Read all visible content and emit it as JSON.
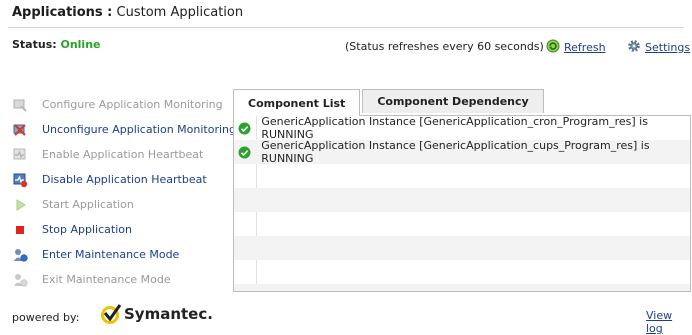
{
  "header": {
    "label": "Applications :",
    "app_name": "Custom Application"
  },
  "status": {
    "label": "Status:",
    "value": "Online",
    "value_color": "#2da12d"
  },
  "refresh": {
    "note": "(Status refreshes every 60 seconds)",
    "refresh_label": "Refresh",
    "settings_label": "Settings"
  },
  "actions": [
    {
      "label": "Configure Application Monitoring",
      "enabled": false,
      "icon": "configure-icon"
    },
    {
      "label": "Unconfigure Application Monitoring",
      "enabled": true,
      "icon": "unconfigure-icon"
    },
    {
      "label": "Enable Application Heartbeat",
      "enabled": false,
      "icon": "enable-heartbeat-icon"
    },
    {
      "label": "Disable Application Heartbeat",
      "enabled": true,
      "icon": "disable-heartbeat-icon"
    },
    {
      "label": "Start Application",
      "enabled": false,
      "icon": "start-icon"
    },
    {
      "label": "Stop Application",
      "enabled": true,
      "icon": "stop-icon"
    },
    {
      "label": "Enter Maintenance Mode",
      "enabled": true,
      "icon": "enter-maintenance-icon"
    },
    {
      "label": "Exit Maintenance Mode",
      "enabled": false,
      "icon": "exit-maintenance-icon"
    }
  ],
  "tabs": [
    {
      "label": "Component List",
      "active": true
    },
    {
      "label": "Component Dependency",
      "active": false
    }
  ],
  "components": [
    {
      "text": "GenericApplication Instance [GenericApplication_cron_Program_res] is RUNNING",
      "status": "running"
    },
    {
      "text": "GenericApplication Instance [GenericApplication_cups_Program_res] is RUNNING",
      "status": "running"
    }
  ],
  "footer": {
    "powered_by": "powered by:",
    "brand": "Symantec.",
    "view_log": "View log"
  },
  "colors": {
    "link": "#1b3f8b",
    "disabled": "#9a9a9a",
    "running": "#2da12d"
  }
}
